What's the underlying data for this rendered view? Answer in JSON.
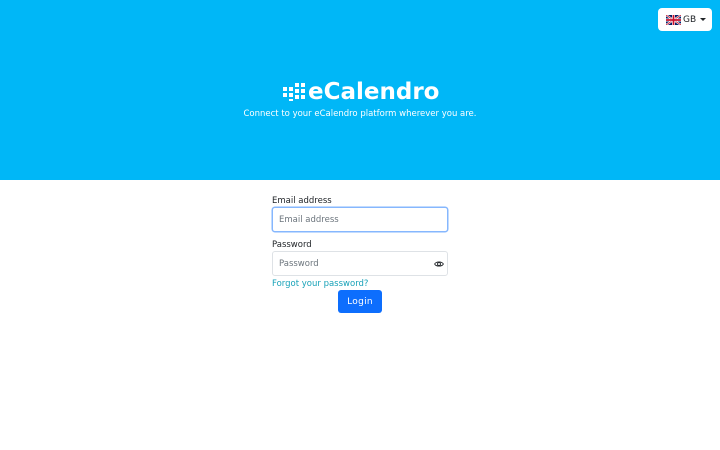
{
  "header": {
    "background_color": "#00b7f7",
    "language": {
      "code": "GB",
      "flag_icon": "uk-flag-icon"
    },
    "logo": {
      "text": "eCalendro",
      "icon": "dot-grid-logo-icon"
    },
    "tagline": "Connect to your eCalendro platform wherever you are."
  },
  "form": {
    "email": {
      "label": "Email address",
      "placeholder": "Email address",
      "value": ""
    },
    "password": {
      "label": "Password",
      "placeholder": "Password",
      "value": "",
      "toggle_icon": "eye-icon"
    },
    "forgot_link": "Forgot your password?",
    "submit_label": "Login",
    "accent_color": "#0d6efd",
    "link_color": "#17a2b8"
  }
}
